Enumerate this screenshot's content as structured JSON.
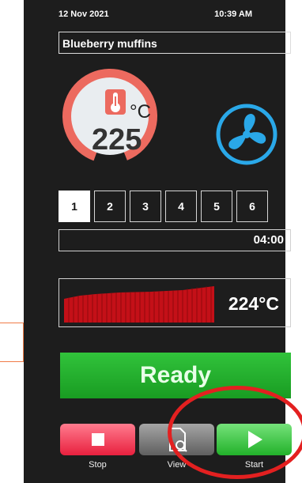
{
  "status": {
    "date": "12 Nov 2021",
    "time": "10:39 AM"
  },
  "recipe": {
    "name": "Blueberry muffins"
  },
  "oven": {
    "set_temp": "225",
    "unit": "°C",
    "current_temp": "224°C"
  },
  "stages": [
    "1",
    "2",
    "3",
    "4",
    "5",
    "6"
  ],
  "timer": {
    "remaining": "04:00"
  },
  "state": {
    "label": "Ready"
  },
  "controls": {
    "stop": "Stop",
    "view": "View",
    "start": "Start"
  },
  "colors": {
    "ready_green": "#24b12c",
    "stop_red": "#ec2c46",
    "fan_blue": "#2aa8e8",
    "graph_red": "#c41018"
  }
}
